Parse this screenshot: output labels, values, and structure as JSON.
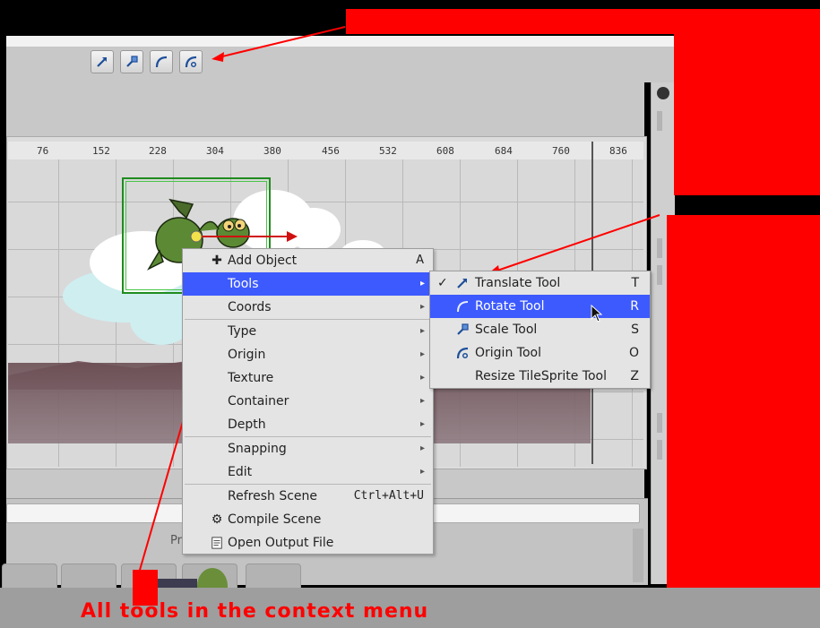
{
  "toolbar": {
    "buttons": [
      {
        "name": "translate-tool-button",
        "icon": "translate-arrow-icon"
      },
      {
        "name": "scale-tool-button",
        "icon": "scale-handle-icon"
      },
      {
        "name": "rotate-tool-button",
        "icon": "rotate-arc-icon"
      },
      {
        "name": "origin-tool-button",
        "icon": "origin-arc-icon"
      }
    ]
  },
  "ruler": {
    "ticks": [
      "76",
      "152",
      "228",
      "304",
      "380",
      "456",
      "532",
      "608",
      "684",
      "760",
      "836"
    ]
  },
  "bottom": {
    "panel_label": "Pr"
  },
  "context_menu": {
    "items": [
      {
        "label": "Add Object",
        "accel": "A",
        "icon": "plus-icon"
      },
      {
        "label": "Tools",
        "submenu": true,
        "active": true
      },
      {
        "label": "Coords",
        "submenu": true
      },
      {
        "label": "Type",
        "submenu": true
      },
      {
        "label": "Origin",
        "submenu": true
      },
      {
        "label": "Texture",
        "submenu": true
      },
      {
        "label": "Container",
        "submenu": true
      },
      {
        "label": "Depth",
        "submenu": true
      },
      {
        "label": "Snapping",
        "submenu": true
      },
      {
        "label": "Edit",
        "submenu": true
      },
      {
        "label": "Refresh Scene",
        "accel": "Ctrl+Alt+U"
      },
      {
        "label": "Compile Scene",
        "icon": "gear-icon"
      },
      {
        "label": "Open Output File",
        "icon": "file-icon"
      }
    ],
    "submenu_arrow": "▸"
  },
  "tools_submenu": {
    "items": [
      {
        "label": "Translate Tool",
        "accel": "T",
        "checked": true,
        "icon": "translate-arrow-icon"
      },
      {
        "label": "Rotate Tool",
        "accel": "R",
        "active": true,
        "icon": "rotate-arc-icon"
      },
      {
        "label": "Scale Tool",
        "accel": "S",
        "icon": "scale-handle-icon"
      },
      {
        "label": "Origin Tool",
        "accel": "O",
        "icon": "origin-arc-icon"
      },
      {
        "label": "Resize TileSprite Tool",
        "accel": "Z"
      }
    ],
    "check_mark": "✓"
  },
  "annotation": {
    "caption": "All tools in the context menu",
    "color": "#ff0000"
  },
  "colors": {
    "menu_highlight": "#3d5afe",
    "selection_green": "#1f8c1f",
    "annotation_red": "#ff0000"
  }
}
